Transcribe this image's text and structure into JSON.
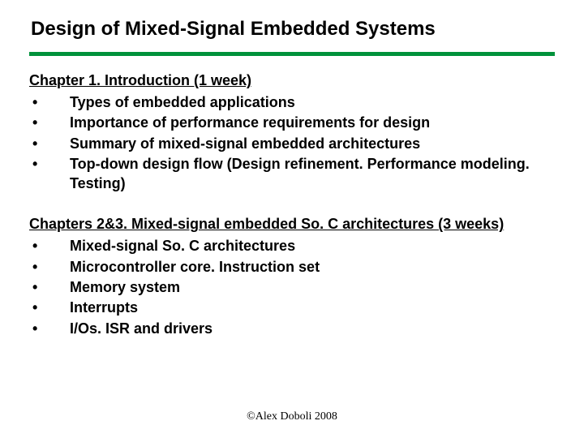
{
  "title": "Design of Mixed-Signal Embedded Systems",
  "sections": [
    {
      "heading": "Chapter 1. Introduction (1 week)",
      "items": [
        "Types of embedded applications",
        "Importance of performance requirements for design",
        "Summary of mixed-signal embedded architectures",
        "Top-down design flow (Design refinement. Performance modeling. Testing)"
      ]
    },
    {
      "heading": "Chapters 2&3. Mixed-signal embedded So. C architectures (3 weeks)",
      "items": [
        "Mixed-signal So. C architectures",
        "Microcontroller core. Instruction set",
        "Memory system",
        "Interrupts",
        "I/Os. ISR and drivers"
      ]
    }
  ],
  "footer": "©Alex Doboli 2008"
}
